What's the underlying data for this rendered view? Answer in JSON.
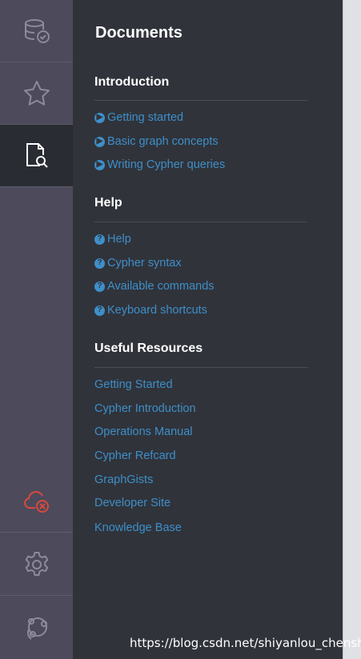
{
  "sidebar": {
    "icons": [
      "database-icon",
      "star-icon",
      "document-search-icon",
      "cloud-disconnected-icon",
      "gear-icon",
      "neo4j-logo-icon"
    ],
    "active": "document-search-icon",
    "colors": {
      "rail": "#4c4a5b",
      "active": "#2a2c33",
      "icon": "#8d8b9a",
      "alert": "#d9493e"
    }
  },
  "drawer": {
    "title": "Documents",
    "introduction": {
      "title": "Introduction",
      "links": [
        "Getting started",
        "Basic graph concepts",
        "Writing Cypher queries"
      ]
    },
    "help": {
      "title": "Help",
      "links": [
        "Help",
        "Cypher syntax",
        "Available commands",
        "Keyboard shortcuts"
      ]
    },
    "resources": {
      "title": "Useful Resources",
      "links": [
        "Getting Started",
        "Cypher Introduction",
        "Operations Manual",
        "Cypher Refcard",
        "GraphGists",
        "Developer Site",
        "Knowledge Base"
      ]
    },
    "link_color": "#3e8fc9"
  },
  "watermark": "https://blog.csdn.net/shiyanlou_chenshi"
}
